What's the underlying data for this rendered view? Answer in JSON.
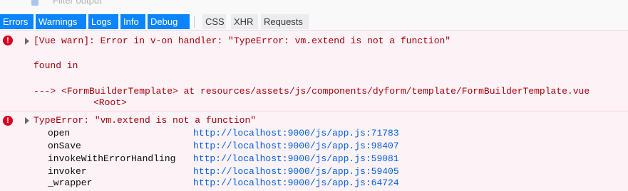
{
  "filter": {
    "placeholder": "Filter output"
  },
  "toolbar": {
    "levels": [
      {
        "label": "Errors"
      },
      {
        "label": "Warnings"
      },
      {
        "label": "Logs"
      },
      {
        "label": "Info"
      },
      {
        "label": "Debug"
      }
    ],
    "types": [
      {
        "label": "CSS"
      },
      {
        "label": "XHR"
      },
      {
        "label": "Requests"
      }
    ]
  },
  "messages": [
    {
      "icon": "error-icon",
      "text": "[Vue warn]: Error in v-on handler: \"TypeError: vm.extend is not a function\"",
      "found_in": "found in",
      "trace_line": "---> <FormBuilderTemplate> at resources/assets/js/components/dyform/template/FormBuilderTemplate.vue",
      "root_line": "<Root>"
    },
    {
      "icon": "error-icon",
      "text": "TypeError: \"vm.extend is not a function\"",
      "stack": [
        {
          "fn": "open",
          "loc": "http://localhost:9000/js/app.js:71783"
        },
        {
          "fn": "onSave",
          "loc": "http://localhost:9000/js/app.js:98407"
        },
        {
          "fn": "invokeWithErrorHandling",
          "loc": "http://localhost:9000/js/app.js:59081"
        },
        {
          "fn": "invoker",
          "loc": "http://localhost:9000/js/app.js:59405"
        },
        {
          "fn": "_wrapper",
          "loc": "http://localhost:9000/js/app.js:64724"
        }
      ]
    }
  ],
  "colors": {
    "accent": "#0a84ff",
    "error": "#d70022",
    "error_text": "#a4000f",
    "link": "#0060df",
    "error_bg": "#fdf2f5"
  }
}
